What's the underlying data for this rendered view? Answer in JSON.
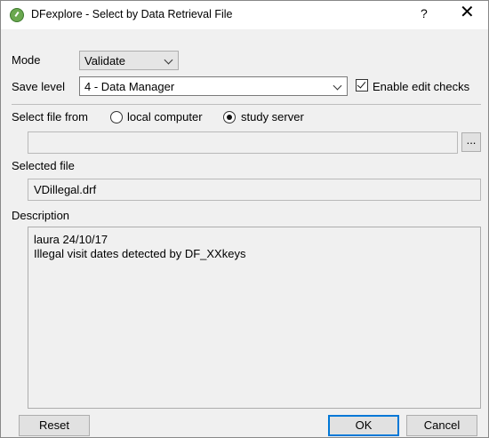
{
  "window": {
    "title": "DFexplore - Select by Data Retrieval File",
    "help_label": "?",
    "close_label": "✕"
  },
  "mode": {
    "label": "Mode",
    "value": "Validate"
  },
  "save_level": {
    "label": "Save level",
    "value": "4 - Data Manager"
  },
  "edit_checks": {
    "label": "Enable edit checks",
    "checked": true
  },
  "select_from": {
    "label": "Select file from",
    "options": [
      {
        "label": "local computer",
        "checked": false
      },
      {
        "label": "study server",
        "checked": true
      }
    ]
  },
  "path": {
    "value": "",
    "browse_label": "..."
  },
  "selected_file": {
    "label": "Selected file",
    "value": "VDillegal.drf"
  },
  "description": {
    "label": "Description",
    "lines": [
      "laura 24/10/17",
      "Illegal visit dates detected by DF_XXkeys"
    ]
  },
  "buttons": {
    "reset": "Reset",
    "ok": "OK",
    "cancel": "Cancel"
  }
}
